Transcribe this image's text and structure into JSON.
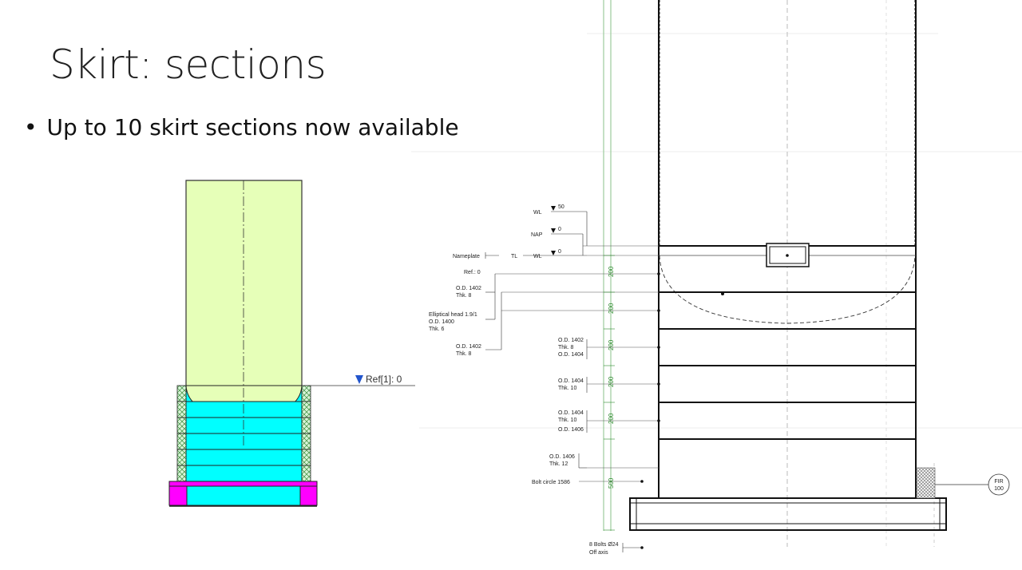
{
  "slide": {
    "title": "Skirt: sections",
    "bullet": "Up to 10 skirt sections now available"
  },
  "left_drawing": {
    "ref_label": "Ref[1]: 0",
    "colors": {
      "shell": "#e6ffb8",
      "skirt_sections": "#00ffff",
      "base_ring": "#ff00ff",
      "hatch": "#7fd07f"
    }
  },
  "right_drawing": {
    "level_markers": [
      {
        "label": "WL",
        "value": "50"
      },
      {
        "label": "NAP",
        "value": "0"
      },
      {
        "label": "WL",
        "value": "0"
      }
    ],
    "nameplate": {
      "label": "Nameplate",
      "tl": "TL"
    },
    "ref": "Ref.: 0",
    "od_1402_a": [
      "O.D. 1402",
      "Thk. 8"
    ],
    "elliptical_head": [
      "Elliptical head 1.9/1",
      "O.D. 1400",
      "Thk. 6"
    ],
    "od_1402_b": [
      "O.D. 1402",
      "Thk. 8"
    ],
    "skirt_1": [
      "O.D. 1402",
      "Thk. 8",
      "O.D. 1404"
    ],
    "skirt_2": [
      "O.D. 1404",
      "Thk. 10"
    ],
    "skirt_3": [
      "O.D. 1404",
      "Thk. 10",
      "O.D. 1406"
    ],
    "skirt_4": [
      "O.D. 1406",
      "Thk. 12"
    ],
    "bolt_circle": "Bolt circle 1586",
    "bolts": [
      "8 Bolts Ø24",
      "Off axis"
    ],
    "dimensions": [
      "200",
      "200",
      "200",
      "200",
      "200",
      "500"
    ],
    "fireproofing": [
      "FIR",
      "100"
    ]
  }
}
